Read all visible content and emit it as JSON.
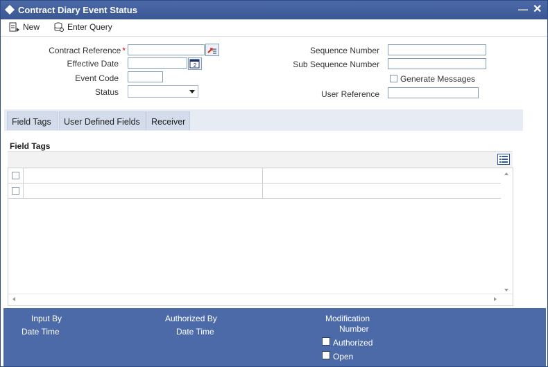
{
  "window": {
    "title": "Contract Diary Event Status"
  },
  "toolbar": {
    "new_label": "New",
    "enter_query_label": "Enter Query"
  },
  "form": {
    "contract_reference_label": "Contract Reference",
    "required_mark": "*",
    "effective_date_label": "Effective Date",
    "event_code_label": "Event Code",
    "status_label": "Status",
    "sequence_number_label": "Sequence Number",
    "sub_sequence_number_label": "Sub Sequence Number",
    "generate_messages_label": "Generate Messages",
    "user_reference_label": "User Reference",
    "contract_reference_value": "",
    "effective_date_value": "",
    "event_code_value": "",
    "status_value": "",
    "sequence_number_value": "",
    "sub_sequence_number_value": "",
    "user_reference_value": ""
  },
  "tabs": [
    {
      "label": "Field Tags"
    },
    {
      "label": "User Defined Fields"
    },
    {
      "label": "Receiver"
    }
  ],
  "field_tags": {
    "section_title": "Field Tags",
    "rows": 2
  },
  "footer": {
    "input_by_label": "Input By",
    "input_date_time_label": "Date Time",
    "authorized_by_label": "Authorized By",
    "authorized_date_time_label": "Date Time",
    "modification_label": "Modification",
    "number_label": "Number",
    "authorized_label": "Authorized",
    "open_label": "Open"
  },
  "colors": {
    "titlebar": "#3a5794",
    "footer": "#4d6aa8",
    "tab_bg": "#d3dcea",
    "required": "#cc0000"
  }
}
